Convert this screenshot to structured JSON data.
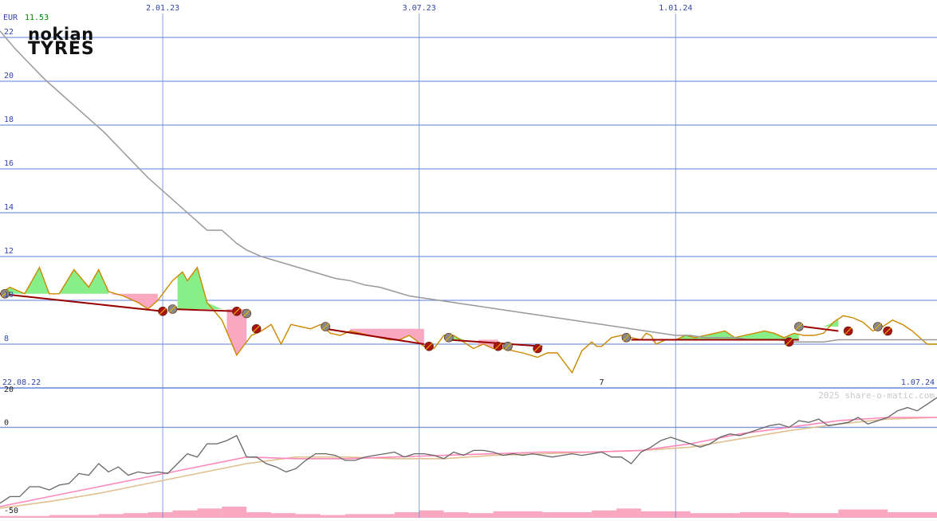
{
  "header": {
    "currency": "EUR",
    "last_price": "11.53"
  },
  "logo": {
    "line1": "nokian",
    "line2": "TYRES"
  },
  "watermark": "2025 share-o-matic.com",
  "colors": {
    "price_line": "#cc8800",
    "moving_average": "#999999",
    "trend_line": "#990000",
    "marker_red": "#aa1111",
    "marker_gray": "#888888",
    "fill_up": "#88ee88",
    "fill_down": "#f8a8c0",
    "grid": "#6688dd",
    "osc_line": "#666666",
    "osc_pink": "#ff88bb",
    "osc_beige": "#e0c090",
    "volume": "#f8a8c0",
    "axis_text": "#3344aa",
    "price_text": "#008800"
  },
  "chart_data": [
    {
      "type": "line",
      "title": "",
      "ylim": [
        6,
        22
      ],
      "y_ticks": [
        8,
        10,
        12,
        14,
        16,
        18,
        20,
        22
      ],
      "y_tick_labels": [
        "8",
        "10",
        "12",
        "14",
        "16",
        "18",
        "20",
        "22"
      ],
      "x_tick_labels": [
        {
          "label": "2.01.23",
          "x": 33
        },
        {
          "label": "3.07.23",
          "x": 85
        },
        {
          "label": "1.01.24",
          "x": 137
        }
      ],
      "x_range_labels": {
        "start": "22.08.22",
        "end": "1.07.24"
      },
      "x_range": [
        0,
        190
      ],
      "annotation": {
        "text": "7",
        "x": 122
      },
      "series": [
        {
          "role": "price",
          "x": [
            0,
            2,
            5,
            8,
            10,
            12,
            15,
            18,
            20,
            22,
            25,
            28,
            30,
            32,
            35,
            37,
            38,
            40,
            42,
            45,
            48,
            49,
            51,
            53,
            55,
            57,
            59,
            63,
            65,
            67,
            69,
            71,
            73,
            75,
            77,
            79,
            81,
            83,
            86,
            88,
            90,
            92,
            94,
            96,
            98,
            100,
            102,
            104,
            106,
            109,
            111,
            113,
            116,
            118,
            120,
            121,
            122,
            124,
            126,
            128,
            130,
            131,
            132,
            133,
            135,
            137,
            139,
            141,
            143,
            145,
            147,
            149,
            151,
            153,
            155,
            157,
            159,
            161,
            163,
            165,
            167,
            169,
            171,
            173,
            175,
            177,
            179,
            181,
            183,
            185,
            188,
            190
          ],
          "values": [
            10.3,
            10.6,
            10.3,
            11.5,
            10.3,
            10.3,
            11.4,
            10.6,
            11.4,
            10.4,
            10.2,
            9.9,
            9.6,
            10.0,
            10.9,
            11.3,
            10.9,
            11.5,
            9.9,
            9.1,
            7.5,
            7.8,
            8.4,
            8.6,
            8.9,
            8.0,
            8.9,
            8.7,
            8.9,
            8.5,
            8.4,
            8.6,
            8.5,
            8.4,
            8.3,
            8.2,
            8.2,
            8.4,
            7.9,
            7.8,
            8.4,
            8.4,
            8.1,
            7.8,
            8.0,
            7.8,
            7.8,
            7.7,
            7.6,
            7.4,
            7.6,
            7.6,
            6.7,
            7.7,
            8.1,
            7.9,
            7.9,
            8.3,
            8.4,
            8.3,
            8.2,
            8.5,
            8.4,
            8.0,
            8.2,
            8.2,
            8.4,
            8.3,
            8.4,
            8.5,
            8.6,
            8.3,
            8.4,
            8.5,
            8.6,
            8.5,
            8.3,
            8.5,
            8.4,
            8.4,
            8.5,
            9.0,
            9.3,
            9.2,
            9.0,
            8.6,
            8.8,
            9.1,
            8.9,
            8.6,
            8.0,
            8.0
          ]
        },
        {
          "role": "moving_average",
          "x": [
            0,
            3,
            6,
            9,
            12,
            15,
            18,
            21,
            24,
            27,
            30,
            33,
            36,
            39,
            42,
            45,
            47,
            48,
            50,
            53,
            56,
            59,
            62,
            65,
            68,
            71,
            74,
            77,
            80,
            83,
            86,
            89,
            92,
            95,
            98,
            101,
            104,
            107,
            110,
            113,
            116,
            119,
            122,
            125,
            128,
            131,
            134,
            137,
            140,
            143,
            146,
            149,
            152,
            155,
            158,
            161,
            164,
            167,
            170,
            173,
            176,
            179,
            182,
            185,
            188,
            190
          ],
          "values": [
            22.3,
            21.5,
            20.8,
            20.1,
            19.5,
            18.9,
            18.3,
            17.7,
            17.0,
            16.3,
            15.6,
            15.0,
            14.4,
            13.8,
            13.2,
            13.2,
            12.8,
            12.6,
            12.3,
            12.0,
            11.8,
            11.6,
            11.4,
            11.2,
            11.0,
            10.9,
            10.7,
            10.6,
            10.4,
            10.2,
            10.1,
            10.0,
            9.9,
            9.8,
            9.7,
            9.6,
            9.5,
            9.4,
            9.3,
            9.2,
            9.1,
            9.0,
            8.9,
            8.8,
            8.7,
            8.6,
            8.5,
            8.4,
            8.4,
            8.3,
            8.3,
            8.3,
            8.2,
            8.2,
            8.2,
            8.1,
            8.1,
            8.1,
            8.2,
            8.2,
            8.2,
            8.2,
            8.2,
            8.2,
            8.2,
            8.2
          ]
        }
      ],
      "shaded_regions": [
        {
          "kind": "up",
          "x_start": 0,
          "x_end": 22,
          "base": 10.3
        },
        {
          "kind": "down",
          "x_start": 22,
          "x_end": 32,
          "base": 10.3
        },
        {
          "kind": "up",
          "x_start": 36,
          "x_end": 46,
          "base": 9.6
        },
        {
          "kind": "down",
          "x_start": 46,
          "x_end": 50,
          "base": 9.6
        },
        {
          "kind": "down",
          "x_start": 71,
          "x_end": 86,
          "base": 8.7
        },
        {
          "kind": "up",
          "x_start": 91,
          "x_end": 97,
          "base": 8.2
        },
        {
          "kind": "down",
          "x_start": 97,
          "x_end": 101,
          "base": 8.2
        },
        {
          "kind": "down",
          "x_start": 128,
          "x_end": 133,
          "base": 8.2
        },
        {
          "kind": "up",
          "x_start": 133,
          "x_end": 162,
          "base": 8.2
        },
        {
          "kind": "up",
          "x_start": 163,
          "x_end": 170,
          "base": 8.8
        }
      ],
      "trend_segments": [
        {
          "x": [
            0,
            33
          ],
          "values": [
            10.3,
            9.5
          ]
        },
        {
          "x": [
            35,
            48
          ],
          "values": [
            9.6,
            9.5
          ]
        },
        {
          "x": [
            66,
            86
          ],
          "values": [
            8.7,
            8.0
          ]
        },
        {
          "x": [
            91,
            110
          ],
          "values": [
            8.2,
            7.9
          ]
        },
        {
          "x": [
            128,
            162
          ],
          "values": [
            8.2,
            8.2
          ]
        },
        {
          "x": [
            163,
            170
          ],
          "values": [
            8.8,
            8.6
          ]
        }
      ],
      "markers": [
        {
          "x": 1,
          "value": 10.3,
          "kind": "gray"
        },
        {
          "x": 33,
          "value": 9.5,
          "kind": "red"
        },
        {
          "x": 35,
          "value": 9.6,
          "kind": "gray"
        },
        {
          "x": 48,
          "value": 9.5,
          "kind": "red"
        },
        {
          "x": 50,
          "value": 9.4,
          "kind": "gray"
        },
        {
          "x": 52,
          "value": 8.7,
          "kind": "red"
        },
        {
          "x": 66,
          "value": 8.8,
          "kind": "gray"
        },
        {
          "x": 87,
          "value": 7.9,
          "kind": "red"
        },
        {
          "x": 91,
          "value": 8.3,
          "kind": "gray"
        },
        {
          "x": 101,
          "value": 7.9,
          "kind": "red"
        },
        {
          "x": 103,
          "value": 7.9,
          "kind": "gray"
        },
        {
          "x": 109,
          "value": 7.8,
          "kind": "red"
        },
        {
          "x": 127,
          "value": 8.3,
          "kind": "gray"
        },
        {
          "x": 160,
          "value": 8.1,
          "kind": "red"
        },
        {
          "x": 162,
          "value": 8.8,
          "kind": "gray"
        },
        {
          "x": 172,
          "value": 8.6,
          "kind": "red"
        },
        {
          "x": 178,
          "value": 8.8,
          "kind": "gray"
        },
        {
          "x": 180,
          "value": 8.6,
          "kind": "red"
        }
      ]
    },
    {
      "type": "line",
      "title": "",
      "ylim": [
        -50,
        20
      ],
      "y_ticks": [
        20,
        0,
        -50
      ],
      "y_tick_labels": [
        "20",
        "0",
        "-50"
      ],
      "x_range": [
        0,
        190
      ],
      "series": [
        {
          "role": "oscillator",
          "x": [
            0,
            2,
            4,
            6,
            8,
            10,
            12,
            14,
            16,
            18,
            20,
            22,
            24,
            26,
            28,
            30,
            32,
            34,
            36,
            38,
            40,
            42,
            44,
            46,
            48,
            50,
            52,
            54,
            56,
            58,
            60,
            62,
            64,
            66,
            68,
            70,
            72,
            74,
            76,
            78,
            80,
            82,
            84,
            86,
            88,
            90,
            92,
            94,
            96,
            98,
            100,
            102,
            104,
            106,
            108,
            110,
            112,
            114,
            116,
            118,
            120,
            122,
            124,
            126,
            128,
            130,
            132,
            134,
            136,
            138,
            140,
            142,
            144,
            146,
            148,
            150,
            152,
            154,
            156,
            158,
            160,
            162,
            164,
            166,
            168,
            170,
            172,
            174,
            176,
            178,
            180,
            182,
            184,
            186,
            188,
            190
          ],
          "values": [
            -46,
            -42,
            -42,
            -36,
            -36,
            -38,
            -35,
            -34,
            -28,
            -29,
            -22,
            -27,
            -24,
            -29,
            -27,
            -28,
            -27,
            -28,
            -22,
            -16,
            -18,
            -10,
            -10,
            -8,
            -5,
            -18,
            -18,
            -22,
            -24,
            -27,
            -25,
            -20,
            -16,
            -16,
            -17,
            -20,
            -20,
            -18,
            -17,
            -16,
            -15,
            -18,
            -16,
            -16,
            -17,
            -19,
            -15,
            -17,
            -14,
            -14,
            -15,
            -17,
            -16,
            -17,
            -16,
            -17,
            -18,
            -17,
            -16,
            -17,
            -16,
            -15,
            -18,
            -18,
            -22,
            -15,
            -12,
            -8,
            -6,
            -8,
            -10,
            -12,
            -10,
            -6,
            -4,
            -5,
            -3,
            -1,
            1,
            2,
            0,
            4,
            3,
            5,
            1,
            2,
            3,
            6,
            2,
            4,
            6,
            10,
            12,
            10,
            14,
            18
          ]
        },
        {
          "role": "signal_pink",
          "x": [
            0,
            10,
            20,
            30,
            40,
            50,
            60,
            70,
            80,
            90,
            100,
            110,
            120,
            130,
            140,
            150,
            160,
            170,
            180,
            190
          ],
          "values": [
            -48,
            -42,
            -36,
            -30,
            -24,
            -18,
            -19,
            -19,
            -18,
            -17,
            -16,
            -15,
            -15,
            -14,
            -10,
            -4,
            0,
            4,
            6,
            6
          ]
        },
        {
          "role": "signal_beige",
          "x": [
            0,
            10,
            20,
            30,
            40,
            50,
            60,
            70,
            80,
            90,
            100,
            110,
            120,
            130,
            140,
            150,
            160,
            170,
            180,
            190
          ],
          "values": [
            -49,
            -45,
            -40,
            -34,
            -28,
            -22,
            -18,
            -18,
            -19,
            -19,
            -17,
            -16,
            -15,
            -14,
            -12,
            -7,
            -2,
            2,
            5,
            6
          ]
        }
      ],
      "volume": {
        "x": [
          0,
          10,
          20,
          25,
          30,
          35,
          40,
          45,
          50,
          55,
          60,
          65,
          70,
          80,
          85,
          90,
          95,
          100,
          110,
          120,
          125,
          130,
          140,
          150,
          160,
          170,
          180,
          190
        ],
        "values": [
          2,
          3,
          4,
          5,
          6,
          8,
          10,
          12,
          6,
          5,
          4,
          3,
          4,
          6,
          8,
          6,
          5,
          7,
          6,
          8,
          10,
          7,
          5,
          6,
          5,
          9,
          6,
          4
        ]
      }
    }
  ]
}
